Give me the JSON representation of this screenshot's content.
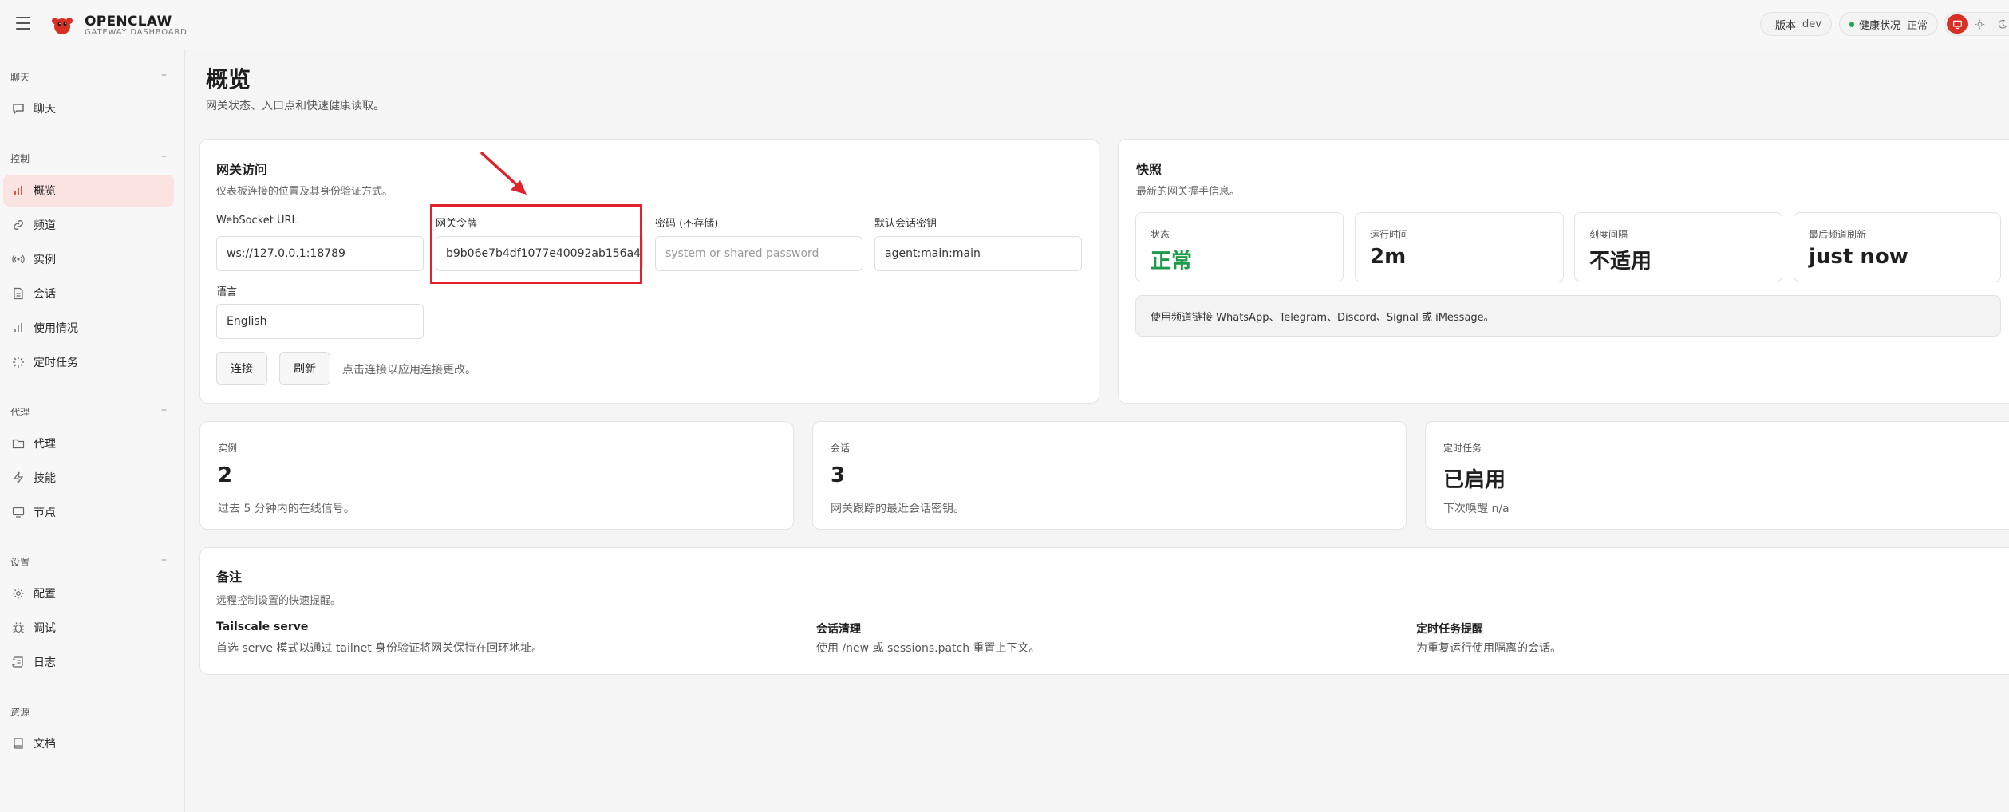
{
  "topbar": {
    "brand_title": "OPENCLAW",
    "brand_subtitle": "GATEWAY DASHBOARD",
    "version_label": "版本",
    "version_value": "dev",
    "health_label": "健康状况",
    "health_value": "正常"
  },
  "sidebar": {
    "sections": [
      {
        "title": "聊天",
        "items": [
          {
            "label": "聊天",
            "icon": "chat-icon"
          }
        ]
      },
      {
        "title": "控制",
        "items": [
          {
            "label": "概览",
            "icon": "bar-chart-icon",
            "active": true
          },
          {
            "label": "频道",
            "icon": "link-icon"
          },
          {
            "label": "实例",
            "icon": "radio-icon"
          },
          {
            "label": "会话",
            "icon": "document-icon"
          },
          {
            "label": "使用情况",
            "icon": "bar-chart-icon"
          },
          {
            "label": "定时任务",
            "icon": "loader-icon"
          }
        ]
      },
      {
        "title": "代理",
        "items": [
          {
            "label": "代理",
            "icon": "folder-icon"
          },
          {
            "label": "技能",
            "icon": "bolt-icon"
          },
          {
            "label": "节点",
            "icon": "monitor-icon"
          }
        ]
      },
      {
        "title": "设置",
        "items": [
          {
            "label": "配置",
            "icon": "gear-icon"
          },
          {
            "label": "调试",
            "icon": "bug-icon"
          },
          {
            "label": "日志",
            "icon": "scroll-icon"
          }
        ]
      },
      {
        "title": "资源",
        "items": [
          {
            "label": "文档",
            "icon": "book-icon"
          }
        ]
      }
    ]
  },
  "page": {
    "title": "概览",
    "subtitle": "网关状态、入口点和快速健康读取。"
  },
  "gateway_access": {
    "title": "网关访问",
    "description": "仪表板连接的位置及其身份验证方式。",
    "websocket_label": "WebSocket URL",
    "websocket_value": "ws://127.0.0.1:18789",
    "token_label": "网关令牌",
    "token_value": "b9b06e7b4df1077e40092ab156a4",
    "password_label": "密码 (不存储)",
    "password_placeholder": "system or shared password",
    "session_key_label": "默认会话密钥",
    "session_key_value": "agent:main:main",
    "language_label": "语言",
    "language_value": "English",
    "connect_label": "连接",
    "refresh_label": "刷新",
    "hint": "点击连接以应用连接更改。"
  },
  "snapshot": {
    "title": "快照",
    "description": "最新的网关握手信息。",
    "tiles": [
      {
        "label": "状态",
        "value": "正常"
      },
      {
        "label": "运行时间",
        "value": "2m"
      },
      {
        "label": "刻度间隔",
        "value": "不适用"
      },
      {
        "label": "最后频道刷新",
        "value": "just now"
      }
    ],
    "info": "使用频道链接 WhatsApp、Telegram、Discord、Signal 或 iMessage。"
  },
  "stats": [
    {
      "label": "实例",
      "value": "2",
      "sub": "过去 5 分钟内的在线信号。"
    },
    {
      "label": "会话",
      "value": "3",
      "sub": "网关跟踪的最近会话密钥。"
    },
    {
      "label": "定时任务",
      "value": "已启用",
      "sub": "下次唤醒 n/a"
    }
  ],
  "notes": {
    "title": "备注",
    "description": "远程控制设置的快速提醒。",
    "items": [
      {
        "title": "Tailscale serve",
        "text": "首选 serve 模式以通过 tailnet 身份验证将网关保持在回环地址。"
      },
      {
        "title": "会话清理",
        "text": "使用 /new 或 sessions.patch 重置上下文。"
      },
      {
        "title": "定时任务提醒",
        "text": "为重复运行使用隔离的会话。"
      }
    ]
  },
  "colors": {
    "accent": "#d93025",
    "ok": "#1e9a4b",
    "annotation": "#e0202a"
  }
}
